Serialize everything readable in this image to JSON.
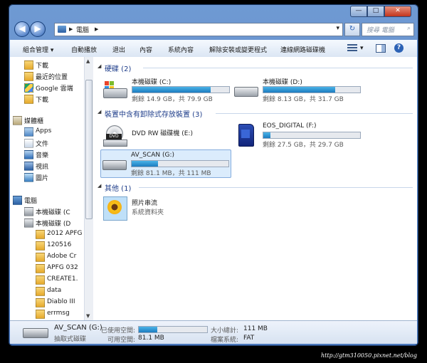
{
  "window": {
    "controls": {
      "minimize": "—",
      "maximize": "□",
      "close": "✕"
    }
  },
  "address": {
    "back": "◀",
    "forward": "▶",
    "path_root": "▶",
    "path_label": "電腦",
    "path_arrow": "▶",
    "dropdown": "▾",
    "refresh": "↻",
    "search_placeholder": "搜尋 電腦"
  },
  "toolbar": {
    "organize": "組合管理 ▾",
    "autoplay": "自動播放",
    "eject": "退出",
    "properties": "內容",
    "system_properties": "系統內容",
    "uninstall": "解除安裝或變更程式",
    "map_drive": "連線網路磁碟機",
    "view_menu": "▾",
    "help": "?"
  },
  "nav": {
    "items": [
      {
        "label": "下載",
        "icon": "download-folder-icon"
      },
      {
        "label": "最近的位置",
        "icon": "recent-places-icon"
      },
      {
        "label": "Google 雲端",
        "icon": "google-drive-icon"
      },
      {
        "label": "下載",
        "icon": "download-folder-icon"
      },
      {
        "label": "媒體櫃",
        "icon": "libraries-icon"
      },
      {
        "label": "Apps",
        "icon": "library-icon"
      },
      {
        "label": "文件",
        "icon": "documents-icon"
      },
      {
        "label": "音樂",
        "icon": "music-icon"
      },
      {
        "label": "視訊",
        "icon": "video-icon"
      },
      {
        "label": "圖片",
        "icon": "pictures-icon"
      },
      {
        "label": "電腦",
        "icon": "computer-icon"
      },
      {
        "label": "本機磁碟 (C",
        "icon": "disk-icon"
      },
      {
        "label": "本機磁碟 (D",
        "icon": "disk-icon"
      },
      {
        "label": "2012 APFG",
        "icon": "folder-icon"
      },
      {
        "label": "120516",
        "icon": "folder-icon"
      },
      {
        "label": "Adobe Cr",
        "icon": "folder-icon"
      },
      {
        "label": "APFG 032",
        "icon": "folder-icon"
      },
      {
        "label": "CREATE1.",
        "icon": "folder-icon"
      },
      {
        "label": "data",
        "icon": "folder-icon"
      },
      {
        "label": "Diablo III",
        "icon": "folder-icon"
      },
      {
        "label": "errmsg",
        "icon": "folder-icon"
      }
    ]
  },
  "groups": {
    "hdd": {
      "title": "硬碟 (2)"
    },
    "removable": {
      "title": "裝置中含有卸除式存放裝置 (3)"
    },
    "other": {
      "title": "其他 (1)"
    }
  },
  "drives": {
    "c": {
      "name": "本機磁碟 (C:)",
      "space": "剩餘 14.9 GB，共 79.9 GB",
      "used_fraction": 0.81
    },
    "d": {
      "name": "本機磁碟 (D:)",
      "space": "剩餘 8.13 GB，共 31.7 GB",
      "used_fraction": 0.74
    },
    "e": {
      "name": "DVD RW 磁碟機 (E:)"
    },
    "f": {
      "name": "EOS_DIGITAL (F:)",
      "space": "剩餘 27.5 GB，共 29.7 GB",
      "used_fraction": 0.07
    },
    "g": {
      "name": "AV_SCAN (G:)",
      "space": "剩餘 81.1 MB，共 111 MB",
      "used_fraction": 0.27
    }
  },
  "other_items": {
    "photo": {
      "name": "照片串流",
      "type": "系統資料夾"
    }
  },
  "status": {
    "name": "AV_SCAN (G:)",
    "type": "抽取式磁碟",
    "used_label": "已使用空間:",
    "free_label": "可用空間:",
    "free_value": "81.1 MB",
    "total_label": "大小總計:",
    "total_value": "111 MB",
    "fs_label": "檔案系統:",
    "fs_value": "FAT",
    "used_fraction": 0.27
  },
  "watermark": "http://gtm310050.pixnet.net/blog"
}
